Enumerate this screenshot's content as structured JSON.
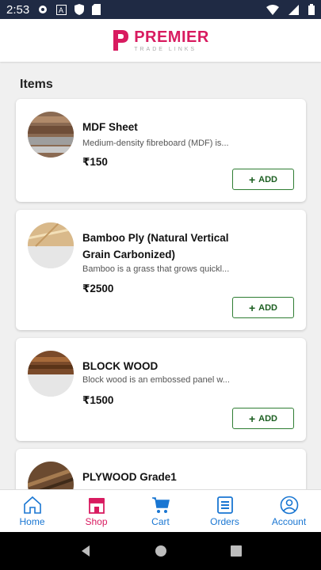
{
  "status_bar": {
    "time": "2:53"
  },
  "app": {
    "brand_title": "PREMIER",
    "brand_subtitle": "TRADE LINKS"
  },
  "section_title": "Items",
  "currency_symbol": "₹",
  "items": [
    {
      "name": "MDF Sheet",
      "description": "Medium-density fibreboard (MDF) is...",
      "price": "₹150",
      "add_label": "ADD"
    },
    {
      "name": "Bamboo Ply (Natural Vertical Grain Carbonized)",
      "description": "Bamboo is a grass that grows quickl...",
      "price": "₹2500",
      "add_label": "ADD"
    },
    {
      "name": "BLOCK WOOD",
      "description": "Block wood is an embossed panel w...",
      "price": "₹1500",
      "add_label": "ADD"
    },
    {
      "name": "PLYWOOD Grade1",
      "description": ""
    }
  ],
  "bottom_nav": [
    {
      "label": "Home",
      "icon": "home-icon"
    },
    {
      "label": "Shop",
      "icon": "shop-icon",
      "active": true
    },
    {
      "label": "Cart",
      "icon": "cart-icon"
    },
    {
      "label": "Orders",
      "icon": "orders-icon"
    },
    {
      "label": "Account",
      "icon": "account-icon"
    }
  ],
  "colors": {
    "brand": "#d81b60",
    "nav_active": "#d81b60",
    "nav_inactive": "#1976d2",
    "add_button": "#1b5e20",
    "status_bar": "#1f2a44"
  }
}
